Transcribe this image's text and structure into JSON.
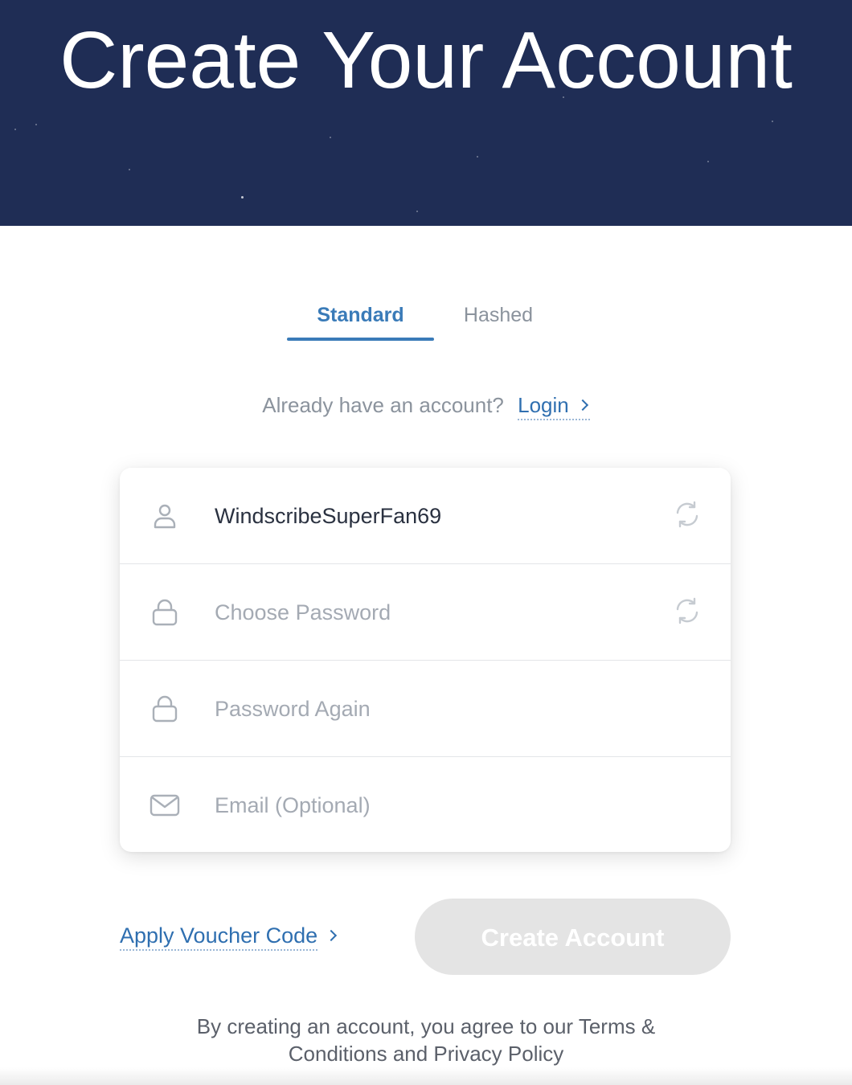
{
  "hero": {
    "title": "Create Your Account",
    "background_color": "#1f2d55"
  },
  "tabs": [
    {
      "label": "Standard",
      "active": true
    },
    {
      "label": "Hashed",
      "active": false
    }
  ],
  "login": {
    "prompt": "Already have an account?",
    "link_label": "Login",
    "icon": "chevron-right-icon"
  },
  "form": {
    "fields": [
      {
        "name": "username",
        "value": "WindscribeSuperFan69",
        "placeholder": "",
        "icon": "user-icon",
        "action_icon": "refresh-icon"
      },
      {
        "name": "password",
        "value": "",
        "placeholder": "Choose Password",
        "icon": "lock-icon",
        "action_icon": "refresh-icon"
      },
      {
        "name": "password_again",
        "value": "",
        "placeholder": "Password Again",
        "icon": "lock-icon",
        "action_icon": ""
      },
      {
        "name": "email",
        "value": "",
        "placeholder": "Email (Optional)",
        "icon": "mail-icon",
        "action_icon": ""
      }
    ]
  },
  "actions": {
    "voucher_label": "Apply Voucher Code",
    "create_label": "Create Account",
    "create_enabled": false
  },
  "terms": {
    "line1": "By creating an account, you agree to our Terms &",
    "line2": "Conditions and Privacy Policy"
  },
  "colors": {
    "accent": "#3a7bb8",
    "link": "#2f6fb0",
    "muted": "#8b939d",
    "button_disabled": "#e4e4e4"
  }
}
